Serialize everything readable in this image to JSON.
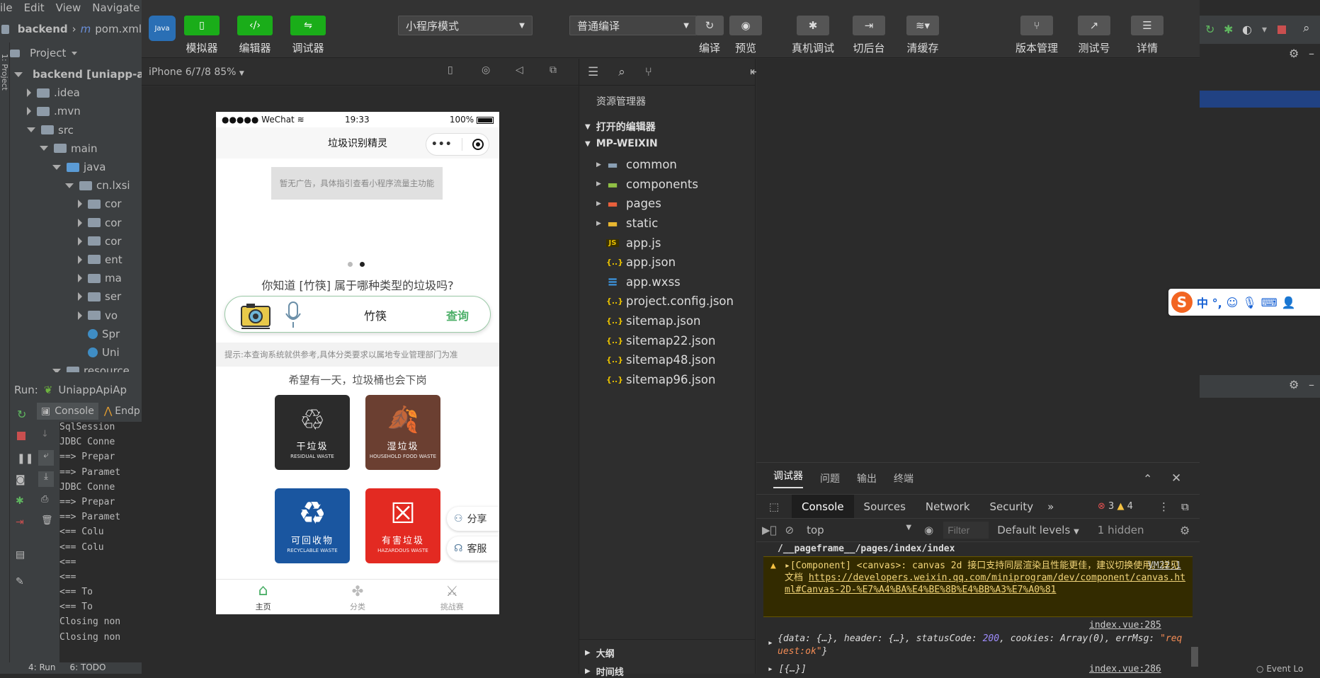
{
  "intellij": {
    "menu": [
      "ile",
      "Edit",
      "View",
      "Navigate"
    ],
    "breadcrumb": [
      "backend",
      "pom.xml"
    ],
    "project_label": "Project",
    "side_tab": "1: Project",
    "tree": [
      {
        "label": "backend [uniapp-a",
        "indent": 0,
        "open": true,
        "kind": "folder"
      },
      {
        "label": ".idea",
        "indent": 1,
        "open": false,
        "kind": "folder"
      },
      {
        "label": ".mvn",
        "indent": 1,
        "open": false,
        "kind": "folder"
      },
      {
        "label": "src",
        "indent": 1,
        "open": true,
        "kind": "folder"
      },
      {
        "label": "main",
        "indent": 2,
        "open": true,
        "kind": "folder"
      },
      {
        "label": "java",
        "indent": 3,
        "open": true,
        "kind": "blue"
      },
      {
        "label": "cn.lxsi",
        "indent": 4,
        "open": true,
        "kind": "folder"
      },
      {
        "label": "cor",
        "indent": 5,
        "open": false,
        "kind": "folder"
      },
      {
        "label": "cor",
        "indent": 5,
        "open": false,
        "kind": "folder"
      },
      {
        "label": "cor",
        "indent": 5,
        "open": false,
        "kind": "folder"
      },
      {
        "label": "ent",
        "indent": 5,
        "open": false,
        "kind": "folder"
      },
      {
        "label": "ma",
        "indent": 5,
        "open": false,
        "kind": "folder"
      },
      {
        "label": "ser",
        "indent": 5,
        "open": false,
        "kind": "folder"
      },
      {
        "label": "vo",
        "indent": 5,
        "open": false,
        "kind": "folder"
      },
      {
        "label": "Spr",
        "indent": 5,
        "open": null,
        "kind": "class"
      },
      {
        "label": "Uni",
        "indent": 5,
        "open": null,
        "kind": "class"
      },
      {
        "label": "resource",
        "indent": 3,
        "open": true,
        "kind": "folder"
      }
    ],
    "run_label": "Run:",
    "run_config": "UniappApiAp",
    "run_tabs": [
      "Console",
      "Endp"
    ],
    "console_lines": [
      "SqlSession",
      "JDBC Conne",
      "==>  Prepar",
      "==> Paramet",
      "JDBC Conne",
      "==>  Prepar",
      "==> Paramet",
      "<==    Colu",
      "<==    Colu",
      "<==",
      "<==",
      "<==      To",
      "<==      To",
      "Closing non",
      "Closing non"
    ],
    "bottom_tabs": [
      "4: Run",
      "6: TODO"
    ],
    "right_bottom": "Event Lo"
  },
  "toolbar": {
    "simulator": "模拟器",
    "editor": "编辑器",
    "debugger": "调试器",
    "mode_select": "小程序模式",
    "compile_select": "普通编译",
    "compile": "编译",
    "preview": "预览",
    "real_debug": "真机调试",
    "background": "切后台",
    "clear_cache": "清缓存",
    "version": "版本管理",
    "test_account": "测试号",
    "details": "详情"
  },
  "simulator": {
    "device": "iPhone 6/7/8 85%"
  },
  "phone": {
    "carrier": "●●●●● WeChat",
    "time": "19:33",
    "battery": "100%",
    "title": "垃圾识别精灵",
    "ad_text": "暂无广告，具体指引查看小程序流量主功能",
    "question": "你知道 [竹筷] 属于哪种类型的垃圾吗?",
    "search_value": "竹筷",
    "search_button": "查询",
    "hint": "提示:本查询系统就供参考,具体分类要求以属地专业管理部门为准",
    "slogan": "希望有一天，垃圾桶也会下岗",
    "bins": [
      {
        "title": "干垃圾",
        "en": "RESIDUAL WASTE",
        "color": "#2b2b2b"
      },
      {
        "title": "湿垃圾",
        "en": "HOUSEHOLD FOOD WASTE",
        "color": "#6b3f31"
      },
      {
        "title": "可回收物",
        "en": "RECYCLABLE WASTE",
        "color": "#1a56a0"
      },
      {
        "title": "有害垃圾",
        "en": "HAZARDOUS WASTE",
        "color": "#e32a22"
      }
    ],
    "share": "分享",
    "service": "客服",
    "tabs": [
      "主页",
      "分类",
      "挑战赛"
    ]
  },
  "explorer": {
    "title": "资源管理器",
    "open_editors": "打开的编辑器",
    "project": "MP-WEIXIN",
    "items": [
      {
        "name": "common",
        "type": "folder",
        "color": "#8aa0b5"
      },
      {
        "name": "components",
        "type": "folder",
        "color": "#8fbf44"
      },
      {
        "name": "pages",
        "type": "folder",
        "color": "#e8603c"
      },
      {
        "name": "static",
        "type": "folder",
        "color": "#e8b730"
      },
      {
        "name": "app.js",
        "type": "js",
        "color": "#e8c100"
      },
      {
        "name": "app.json",
        "type": "json",
        "color": "#e8c100"
      },
      {
        "name": "app.wxss",
        "type": "css",
        "color": "#3d9be9"
      },
      {
        "name": "project.config.json",
        "type": "json",
        "color": "#e8c100"
      },
      {
        "name": "sitemap.json",
        "type": "json",
        "color": "#e8c100"
      },
      {
        "name": "sitemap22.json",
        "type": "json",
        "color": "#e8c100"
      },
      {
        "name": "sitemap48.json",
        "type": "json",
        "color": "#e8c100"
      },
      {
        "name": "sitemap96.json",
        "type": "json",
        "color": "#e8c100"
      }
    ],
    "outline": "大纲",
    "timeline": "时间线"
  },
  "devtools": {
    "tabs": [
      "调试器",
      "问题",
      "输出",
      "终端"
    ],
    "panels": [
      "Console",
      "Sources",
      "Network",
      "Security"
    ],
    "errors": "3",
    "warnings": "4",
    "context": "top",
    "filter_placeholder": "Filter",
    "levels": "Default levels",
    "hidden": "1 hidden",
    "path_line": "/__pageframe__/pages/index/index",
    "warn_msg": "[Component] <canvas>: canvas 2d 接口支持同层渲染且性能更佳，建议切换使用。详见文档",
    "warn_link": "https://developers.weixin.qq.com/miniprogram/dev/component/canvas.html#Canvas-2D-%E7%A4%BA%E4%BE%8B%E4%BB%A3%E7%A0%81",
    "warn_src": "VM22:1",
    "log1_src": "index.vue:285",
    "log1_pre": "{data: {…}, header: {…}, statusCode: ",
    "log1_code": "200",
    "log1_mid": ", cookies: Array(0), errMsg: ",
    "log1_msg": "\"request:ok\"",
    "log1_end": "}",
    "log2_src": "index.vue:286",
    "log2": "[{…}]"
  },
  "ime": {
    "logo": "S",
    "text": "中 °,"
  }
}
